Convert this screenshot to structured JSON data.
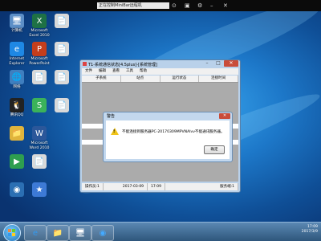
{
  "remote_bar": {
    "caption": "正在控制MiniBar远程机"
  },
  "desktop_icons": [
    {
      "label": "计算机",
      "glyph": "🖥",
      "color": "#5c8fc7"
    },
    {
      "label": "Internet\nExplorer",
      "glyph": "e",
      "color": "#1e88e5"
    },
    {
      "label": "网络",
      "glyph": "🌐",
      "color": "#3f7fbf"
    },
    {
      "label": "腾讯QQ",
      "glyph": "🐧",
      "color": "#222222"
    },
    {
      "label": "",
      "glyph": "📁",
      "color": "#e0b43c"
    },
    {
      "label": "",
      "glyph": "▶",
      "color": "#2e9e4f"
    },
    {
      "label": "",
      "glyph": "◉",
      "color": "#2b6fb3"
    },
    {
      "label": "",
      "glyph": "⚙",
      "color": "#6b6b6b"
    },
    {
      "label": "",
      "glyph": "🗑",
      "color": "#7aa7d6"
    },
    {
      "label": "",
      "glyph": "📁",
      "color": "#e0b43c"
    },
    {
      "label": "Microsoft\nExcel 2010",
      "glyph": "X",
      "color": "#1e7145"
    },
    {
      "label": "Microsoft\nPowerPoint",
      "glyph": "P",
      "color": "#c43e1c"
    },
    {
      "label": "",
      "glyph": "📄",
      "color": "#d9d9d9"
    },
    {
      "label": "",
      "glyph": "S",
      "color": "#3bb25a"
    },
    {
      "label": "Microsoft\nWord 2010",
      "glyph": "W",
      "color": "#2b579a"
    },
    {
      "label": "",
      "glyph": "📄",
      "color": "#d9d9d9"
    },
    {
      "label": "",
      "glyph": "★",
      "color": "#3d7ad6"
    },
    {
      "label": "",
      "glyph": "📁",
      "color": "#e0b43c"
    },
    {
      "label": "",
      "glyph": "📁",
      "color": "#e0b43c"
    },
    {
      "label": "",
      "glyph": "📄",
      "color": "#d9d9d9"
    },
    {
      "label": "",
      "glyph": "📄",
      "color": "#d9d9d9"
    },
    {
      "label": "",
      "glyph": "📄",
      "color": "#d9d9d9"
    },
    {
      "label": "",
      "glyph": "📄",
      "color": "#d9d9d9"
    },
    {
      "label": "",
      "glyph": "📄",
      "color": "#d9d9d9"
    }
  ],
  "app_window": {
    "title": "T1-系统通信状态[4.5plus]-[系统管理]",
    "menu": [
      "文件",
      "编辑",
      "查看",
      "工具",
      "帮助"
    ],
    "columns": [
      "子系统",
      "站点",
      "运行状态",
      "连接时间"
    ],
    "status": [
      "操作员:1",
      "2017-03-09",
      "17:09",
      "服务端:1"
    ]
  },
  "dialog": {
    "title": "警告",
    "close": "✕",
    "message": "不能连接到服务器PC-20170309MPVNAlvv不能通讯服务器。",
    "ok": "确定"
  },
  "taskbar": {
    "items": [
      "e",
      "📁",
      "🖥",
      "◉"
    ],
    "tray_time": "17:09",
    "tray_date": "2017/3/9"
  }
}
